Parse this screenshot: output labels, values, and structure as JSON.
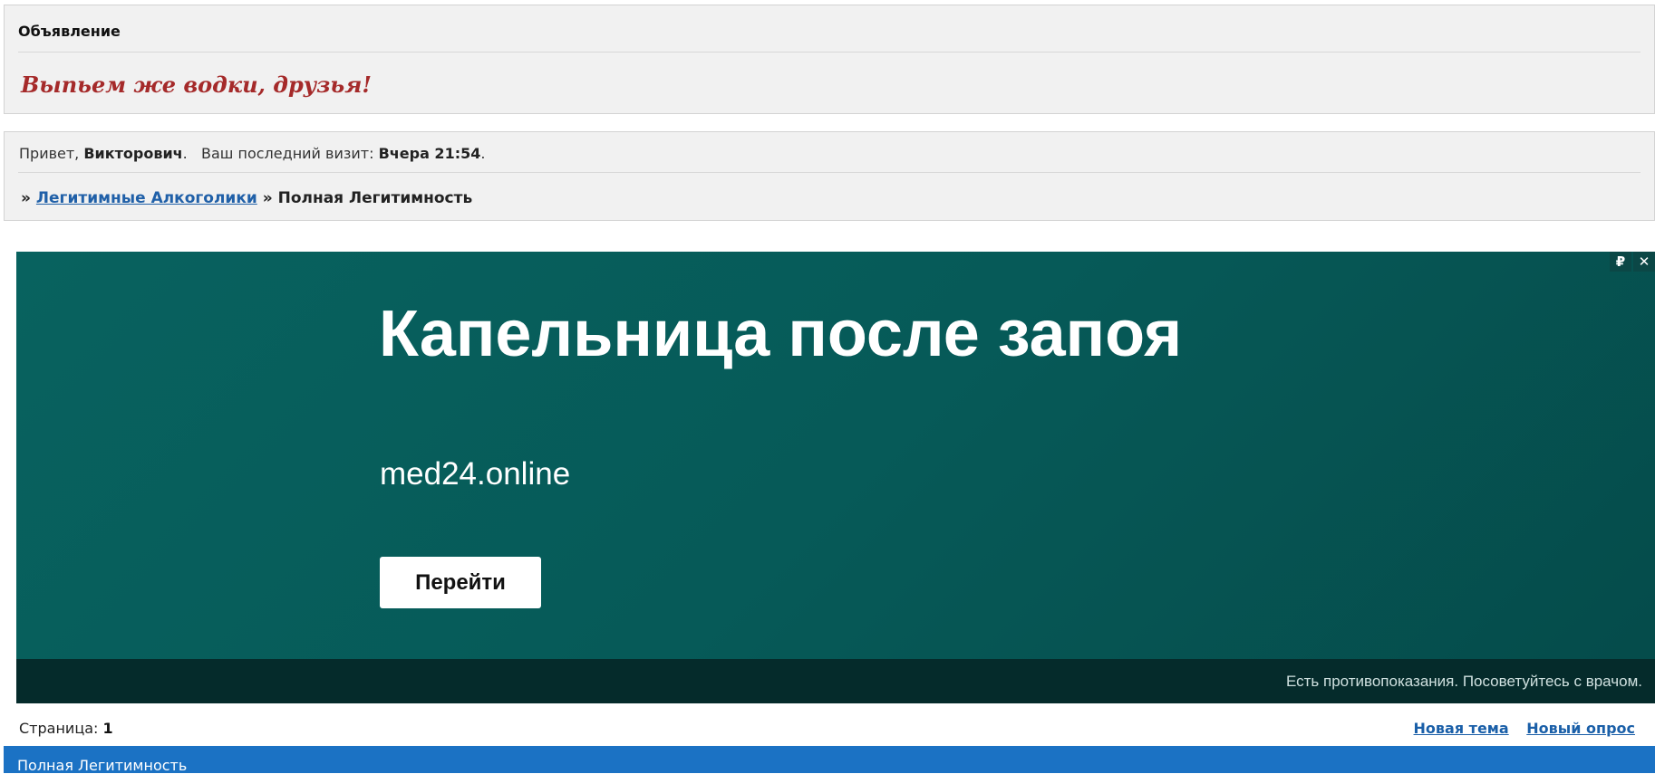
{
  "announcement": {
    "heading": "Объявление",
    "message": "Выпьем же водки, друзья!"
  },
  "welcome": {
    "greeting_prefix": "Привет,",
    "username": "Викторович",
    "last_visit_label": "Ваш последний визит:",
    "last_visit_value": "Вчера 21:54"
  },
  "breadcrumb": {
    "separator": "»",
    "forum_link": "Легитимные Алкоголики",
    "current": "Полная Легитимность"
  },
  "ad": {
    "title": "Капельница после запоя",
    "domain": "med24.online",
    "button_label": "Перейти",
    "disclaimer": "Есть противопоказания. Посоветуйтесь с врачом.",
    "rub_icon_glyph": "₽",
    "close_icon_glyph": "✕"
  },
  "pagination": {
    "label": "Страница:",
    "current_page": "1"
  },
  "actions": {
    "new_topic": "Новая тема",
    "new_poll": "Новый опрос"
  },
  "forum_header": {
    "title": "Полная Легитимность"
  },
  "colors": {
    "accent": "#1b72c4",
    "announcement_text": "#a52a2a",
    "link": "#1a5fa8",
    "ad_bg": "#065a58"
  }
}
